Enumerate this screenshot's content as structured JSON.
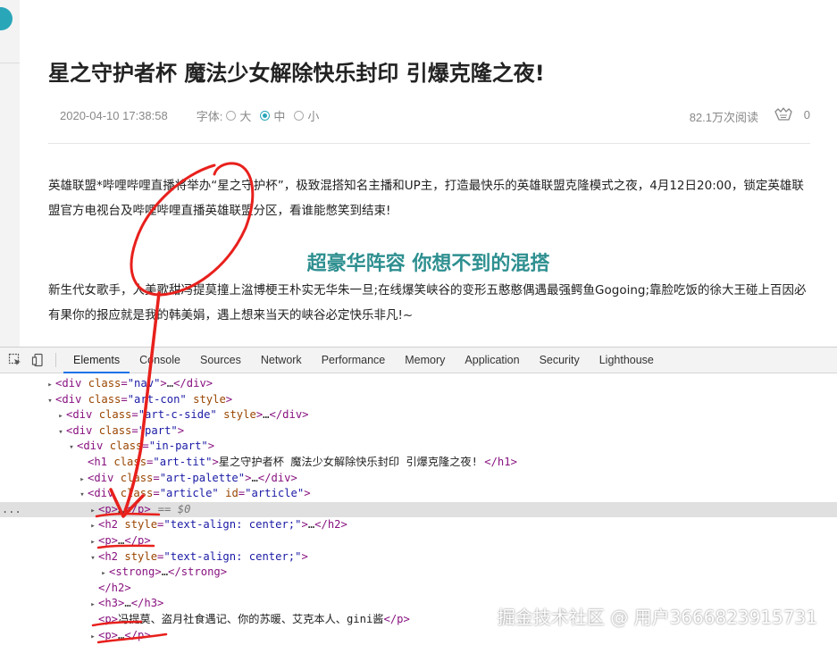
{
  "article": {
    "title": "星之守护者杯 魔法少女解除快乐封印 引爆克隆之夜!",
    "date": "2020-04-10 17:38:58",
    "font_size_label": "字体:",
    "font_sizes": [
      {
        "label": "大",
        "checked": false
      },
      {
        "label": "中",
        "checked": true
      },
      {
        "label": "小",
        "checked": false
      }
    ],
    "reads": "82.1万次阅读",
    "likes": "0",
    "like_icon": "hand-clap-icon",
    "paragraph1": "英雄联盟*哔哩哔哩直播将举办“星之守护杯”，极致混搭知名主播和UP主，打造最快乐的英雄联盟克隆模式之夜，4月12日20:00，锁定英雄联盟官方电视台及哔哩哔哩直播英雄联盟分区，看谁能憋笑到结束!",
    "subheading": "超豪华阵容 你想不到的混搭",
    "paragraph2": "新生代女歌手，人美歌甜冯提莫撞上湓博梗王朴实无华朱一旦;在线爆笑峡谷的变形五憨憨偶遇最强鳄鱼Gogoing;靠脸吃饭的徐大王碰上百因必有果你的报应就是我的韩美娟，遇上想来当天的峡谷必定快乐非凡!~"
  },
  "devtools": {
    "toolbar_icons": [
      "inspect-icon",
      "device-toolbar-icon"
    ],
    "tabs": [
      {
        "label": "Elements",
        "active": true
      },
      {
        "label": "Console",
        "active": false
      },
      {
        "label": "Sources",
        "active": false
      },
      {
        "label": "Network",
        "active": false
      },
      {
        "label": "Performance",
        "active": false
      },
      {
        "label": "Memory",
        "active": false
      },
      {
        "label": "Application",
        "active": false
      },
      {
        "label": "Security",
        "active": false
      },
      {
        "label": "Lighthouse",
        "active": false
      }
    ],
    "gutter_ellipsis": "...",
    "selected_marker": "== $0",
    "dom_rows": [
      {
        "indent": 0,
        "arrow": "▸",
        "parts": [
          [
            "tag",
            "<div "
          ],
          [
            "attr",
            "class"
          ],
          [
            "tag",
            "="
          ],
          [
            "val",
            "\"nav\""
          ],
          [
            "tag",
            ">"
          ],
          [
            "txt",
            "…"
          ],
          [
            "tag",
            "</div>"
          ]
        ]
      },
      {
        "indent": 0,
        "arrow": "▾",
        "parts": [
          [
            "tag",
            "<div "
          ],
          [
            "attr",
            "class"
          ],
          [
            "tag",
            "="
          ],
          [
            "val",
            "\"art-con\""
          ],
          [
            "tag",
            " "
          ],
          [
            "attr",
            "style"
          ],
          [
            "tag",
            ">"
          ]
        ]
      },
      {
        "indent": 1,
        "arrow": "▸",
        "parts": [
          [
            "tag",
            "<div "
          ],
          [
            "attr",
            "class"
          ],
          [
            "tag",
            "="
          ],
          [
            "val",
            "\"art-c-side\""
          ],
          [
            "tag",
            " "
          ],
          [
            "attr",
            "style"
          ],
          [
            "tag",
            ">"
          ],
          [
            "txt",
            "…"
          ],
          [
            "tag",
            "</div>"
          ]
        ]
      },
      {
        "indent": 1,
        "arrow": "▾",
        "parts": [
          [
            "tag",
            "<div "
          ],
          [
            "attr",
            "class"
          ],
          [
            "tag",
            "="
          ],
          [
            "val",
            "\"part\""
          ],
          [
            "tag",
            ">"
          ]
        ]
      },
      {
        "indent": 2,
        "arrow": "▾",
        "parts": [
          [
            "tag",
            "<div "
          ],
          [
            "attr",
            "class"
          ],
          [
            "tag",
            "="
          ],
          [
            "val",
            "\"in-part\""
          ],
          [
            "tag",
            ">"
          ]
        ]
      },
      {
        "indent": 3,
        "arrow": "",
        "parts": [
          [
            "tag",
            "<h1 "
          ],
          [
            "attr",
            "class"
          ],
          [
            "tag",
            "="
          ],
          [
            "val",
            "\"art-tit\""
          ],
          [
            "tag",
            ">"
          ],
          [
            "txt",
            "星之守护者杯 魔法少女解除快乐封印 引爆克隆之夜!"
          ],
          [
            "tag",
            " </h1>"
          ]
        ]
      },
      {
        "indent": 3,
        "arrow": "▸",
        "parts": [
          [
            "tag",
            "<div "
          ],
          [
            "attr",
            "class"
          ],
          [
            "tag",
            "="
          ],
          [
            "val",
            "\"art-palette\""
          ],
          [
            "tag",
            ">"
          ],
          [
            "txt",
            "…"
          ],
          [
            "tag",
            "</div>"
          ]
        ]
      },
      {
        "indent": 3,
        "arrow": "▾",
        "parts": [
          [
            "tag",
            "<div "
          ],
          [
            "attr",
            "class"
          ],
          [
            "tag",
            "="
          ],
          [
            "val",
            "\"article\""
          ],
          [
            "tag",
            " "
          ],
          [
            "attr",
            "id"
          ],
          [
            "tag",
            "="
          ],
          [
            "val",
            "\"article\""
          ],
          [
            "tag",
            ">"
          ]
        ]
      },
      {
        "indent": 4,
        "arrow": "▸",
        "selected": true,
        "parts": [
          [
            "tag",
            "<p>"
          ],
          [
            "txt",
            "…"
          ],
          [
            "tag",
            "</p>"
          ]
        ]
      },
      {
        "indent": 4,
        "arrow": "▸",
        "parts": [
          [
            "tag",
            "<h2 "
          ],
          [
            "attr",
            "style"
          ],
          [
            "tag",
            "="
          ],
          [
            "val",
            "\"text-align: center;\""
          ],
          [
            "tag",
            ">"
          ],
          [
            "txt",
            "…"
          ],
          [
            "tag",
            "</h2>"
          ]
        ]
      },
      {
        "indent": 4,
        "arrow": "▸",
        "parts": [
          [
            "tag",
            "<p>"
          ],
          [
            "txt",
            "…"
          ],
          [
            "tag",
            "</p>"
          ]
        ]
      },
      {
        "indent": 4,
        "arrow": "▾",
        "parts": [
          [
            "tag",
            "<h2 "
          ],
          [
            "attr",
            "style"
          ],
          [
            "tag",
            "="
          ],
          [
            "val",
            "\"text-align: center;\""
          ],
          [
            "tag",
            ">"
          ]
        ]
      },
      {
        "indent": 5,
        "arrow": "▸",
        "parts": [
          [
            "tag",
            "<strong>"
          ],
          [
            "txt",
            "…"
          ],
          [
            "tag",
            "</strong>"
          ]
        ]
      },
      {
        "indent": 4,
        "arrow": "",
        "parts": [
          [
            "tag",
            "</h2>"
          ]
        ]
      },
      {
        "indent": 4,
        "arrow": "▸",
        "parts": [
          [
            "tag",
            "<h3>"
          ],
          [
            "txt",
            "…"
          ],
          [
            "tag",
            "</h3>"
          ]
        ]
      },
      {
        "indent": 4,
        "arrow": "",
        "parts": [
          [
            "tag",
            "<p>"
          ],
          [
            "txt",
            "冯提莫、盗月社食遇记、你的苏暖、艾克本人、gini酱"
          ],
          [
            "tag",
            "</p>"
          ]
        ]
      },
      {
        "indent": 4,
        "arrow": "▸",
        "parts": [
          [
            "tag",
            "<p>"
          ],
          [
            "txt",
            "…"
          ],
          [
            "tag",
            "</p>"
          ]
        ]
      }
    ]
  },
  "watermark": "掘金技术社区 @ 用户3666823915731",
  "annotation_color": "#e8201c"
}
